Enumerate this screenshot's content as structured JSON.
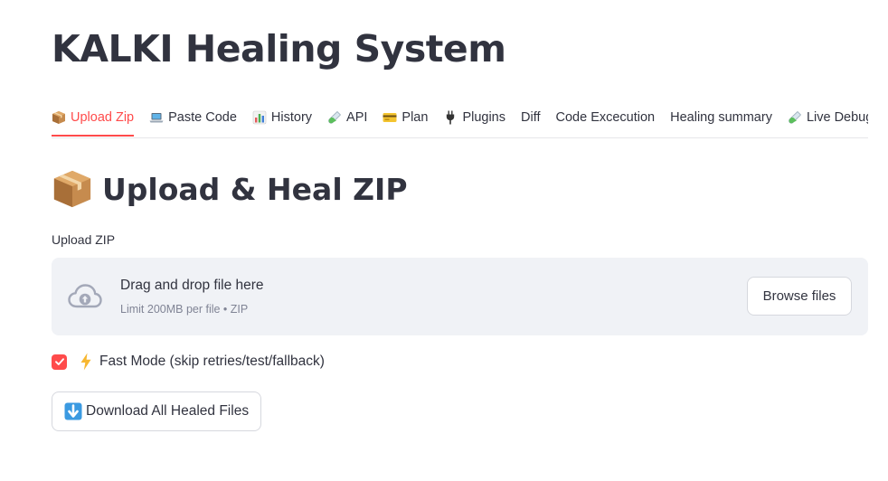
{
  "app": {
    "title": "KALKI Healing System"
  },
  "tabs": [
    {
      "label": "Upload Zip",
      "icon": "package-icon",
      "active": true
    },
    {
      "label": "Paste Code",
      "icon": "laptop-icon",
      "active": false
    },
    {
      "label": "History",
      "icon": "bar-chart-icon",
      "active": false
    },
    {
      "label": "API",
      "icon": "test-tube-icon",
      "active": false
    },
    {
      "label": "Plan",
      "icon": "credit-card-icon",
      "active": false
    },
    {
      "label": "Plugins",
      "icon": "plug-icon",
      "active": false
    },
    {
      "label": "Diff",
      "icon": "",
      "active": false
    },
    {
      "label": "Code Excecution",
      "icon": "",
      "active": false
    },
    {
      "label": "Healing summary",
      "icon": "",
      "active": false
    },
    {
      "label": "Live Debug",
      "icon": "test-tube-icon",
      "active": false
    }
  ],
  "section": {
    "heading": "Upload & Heal ZIP",
    "icon": "package-icon"
  },
  "uploader": {
    "label": "Upload ZIP",
    "drop_text": "Drag and drop file here",
    "limit_text": "Limit 200MB per file • ZIP",
    "browse_label": "Browse files",
    "icon": "cloud-upload-icon"
  },
  "fast_mode": {
    "checked": true,
    "icon": "lightning-icon",
    "label": "Fast Mode (skip retries/test/fallback)"
  },
  "download": {
    "icon": "down-arrow-icon",
    "label": "Download All Healed Files"
  },
  "colors": {
    "accent": "#ff4b4b",
    "text": "#31333f",
    "muted": "#808495",
    "dropzone_bg": "#f0f2f6"
  }
}
